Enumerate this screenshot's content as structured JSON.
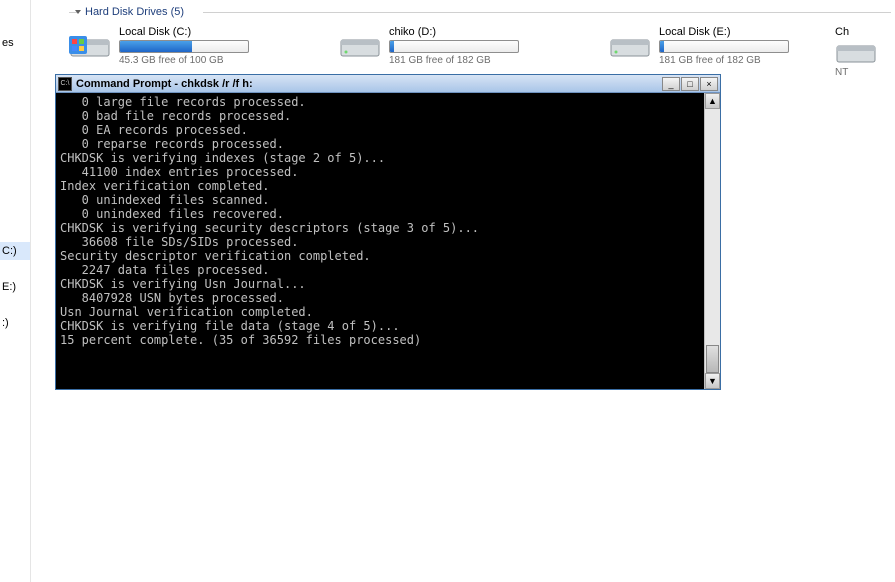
{
  "left_panel": {
    "items": [
      "es",
      "C:)",
      "E:)",
      ":)"
    ]
  },
  "section": {
    "header": "Hard Disk Drives (5)"
  },
  "drives": [
    {
      "name": "Local Disk (C:)",
      "free": "45.3 GB free of 100 GB",
      "fill_pct": 56,
      "has_logo": true
    },
    {
      "name": "chiko (D:)",
      "free": "181 GB free of 182 GB",
      "fill_pct": 3,
      "has_logo": false
    },
    {
      "name": "Local Disk (E:)",
      "free": "181 GB free of 182 GB",
      "fill_pct": 3,
      "has_logo": false
    }
  ],
  "partial_drive": {
    "name": "Ch",
    "sub": "NT"
  },
  "cmd": {
    "title": "Command Prompt - chkdsk  /r /f h:",
    "min": "_",
    "max": "□",
    "close": "×",
    "lines": [
      "   0 large file records processed.",
      "   0 bad file records processed.",
      "   0 EA records processed.",
      "   0 reparse records processed.",
      "CHKDSK is verifying indexes (stage 2 of 5)...",
      "   41100 index entries processed.",
      "Index verification completed.",
      "   0 unindexed files scanned.",
      "   0 unindexed files recovered.",
      "CHKDSK is verifying security descriptors (stage 3 of 5)...",
      "   36608 file SDs/SIDs processed.",
      "Security descriptor verification completed.",
      "   2247 data files processed.",
      "CHKDSK is verifying Usn Journal...",
      "   8407928 USN bytes processed.",
      "Usn Journal verification completed.",
      "CHKDSK is verifying file data (stage 4 of 5)...",
      "15 percent complete. (35 of 36592 files processed)"
    ]
  }
}
